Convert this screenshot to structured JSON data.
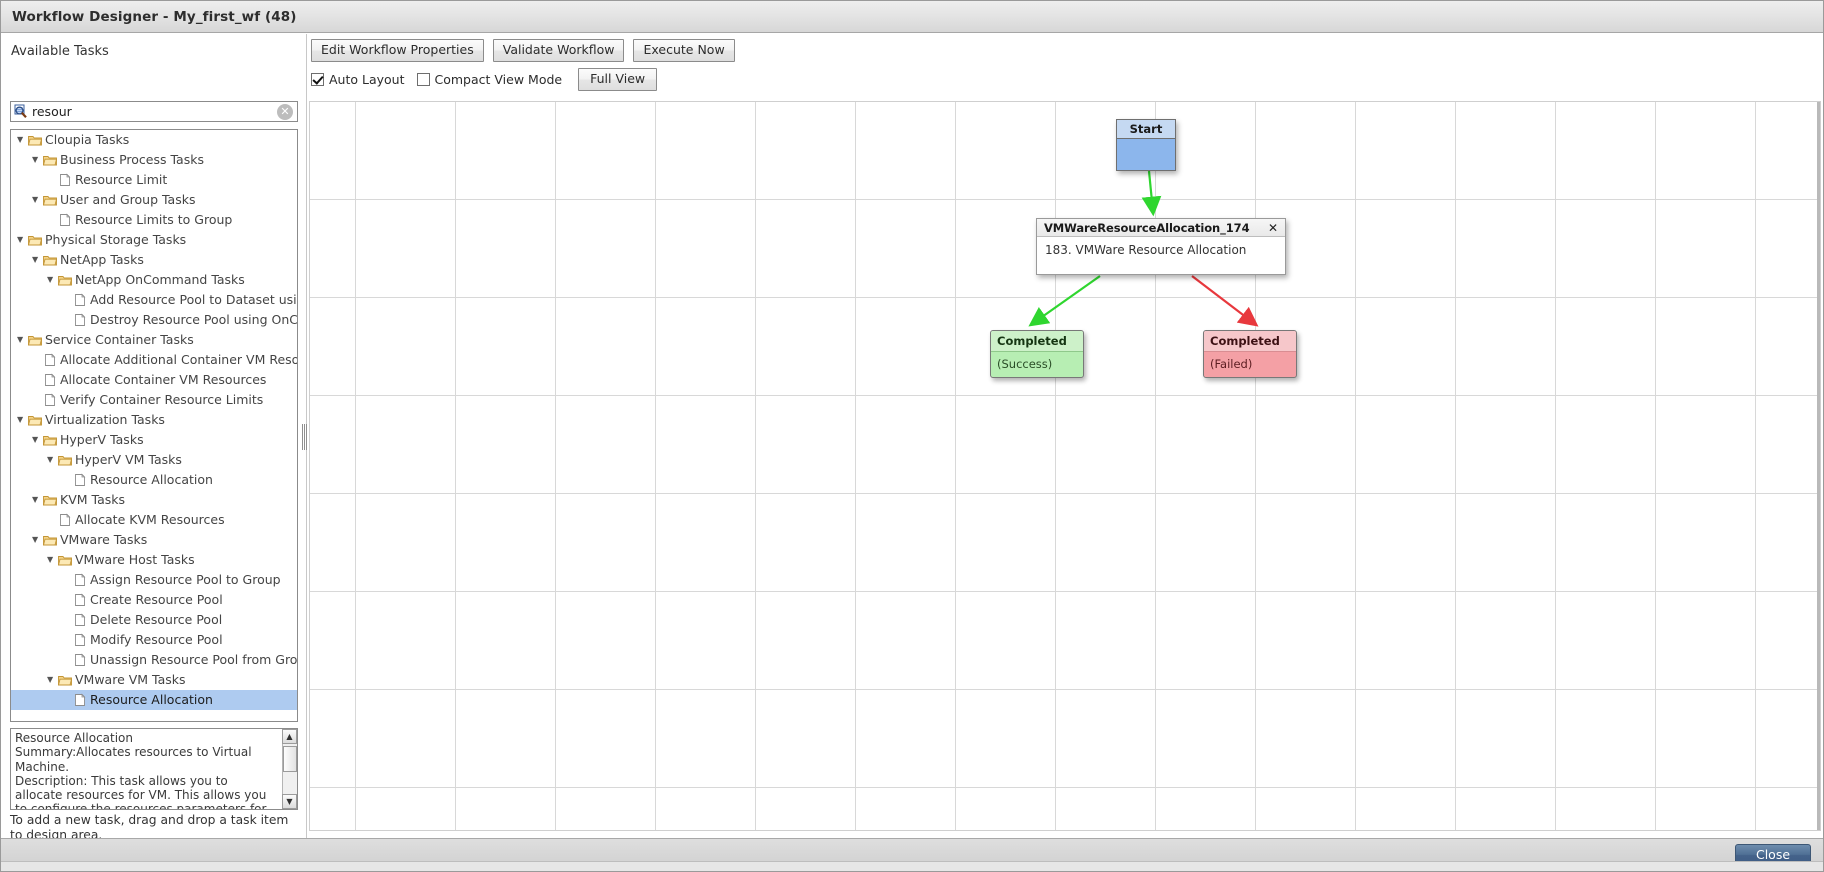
{
  "window": {
    "title": "Workflow Designer - My_first_wf (48)"
  },
  "left_panel": {
    "available_tasks_label": "Available Tasks",
    "search": {
      "value": "resour",
      "placeholder": "",
      "icon": "search-icon",
      "clear_icon": "clear-icon"
    },
    "tree": [
      {
        "label": "Cloupia Tasks",
        "type": "folder",
        "depth": 0,
        "expanded": true,
        "selected": false
      },
      {
        "label": "Business Process Tasks",
        "type": "folder",
        "depth": 1,
        "expanded": true,
        "selected": false
      },
      {
        "label": "Resource Limit",
        "type": "task",
        "depth": 2,
        "expanded": null,
        "selected": false
      },
      {
        "label": "User and Group Tasks",
        "type": "folder",
        "depth": 1,
        "expanded": true,
        "selected": false
      },
      {
        "label": "Resource Limits to Group",
        "type": "task",
        "depth": 2,
        "expanded": null,
        "selected": false
      },
      {
        "label": "Physical Storage Tasks",
        "type": "folder",
        "depth": 0,
        "expanded": true,
        "selected": false
      },
      {
        "label": "NetApp Tasks",
        "type": "folder",
        "depth": 1,
        "expanded": true,
        "selected": false
      },
      {
        "label": "NetApp OnCommand Tasks",
        "type": "folder",
        "depth": 2,
        "expanded": true,
        "selected": false
      },
      {
        "label": "Add Resource Pool to Dataset using",
        "type": "task",
        "depth": 3,
        "expanded": null,
        "selected": false
      },
      {
        "label": "Destroy Resource Pool using OnCo",
        "type": "task",
        "depth": 3,
        "expanded": null,
        "selected": false
      },
      {
        "label": "Service Container Tasks",
        "type": "folder",
        "depth": 0,
        "expanded": true,
        "selected": false
      },
      {
        "label": "Allocate Additional Container VM Resourc",
        "type": "task",
        "depth": 1,
        "expanded": null,
        "selected": false
      },
      {
        "label": "Allocate Container VM Resources",
        "type": "task",
        "depth": 1,
        "expanded": null,
        "selected": false
      },
      {
        "label": "Verify Container Resource Limits",
        "type": "task",
        "depth": 1,
        "expanded": null,
        "selected": false
      },
      {
        "label": "Virtualization Tasks",
        "type": "folder",
        "depth": 0,
        "expanded": true,
        "selected": false
      },
      {
        "label": "HyperV Tasks",
        "type": "folder",
        "depth": 1,
        "expanded": true,
        "selected": false
      },
      {
        "label": "HyperV VM Tasks",
        "type": "folder",
        "depth": 2,
        "expanded": true,
        "selected": false
      },
      {
        "label": "Resource Allocation",
        "type": "task",
        "depth": 3,
        "expanded": null,
        "selected": false
      },
      {
        "label": "KVM Tasks",
        "type": "folder",
        "depth": 1,
        "expanded": true,
        "selected": false
      },
      {
        "label": "Allocate KVM Resources",
        "type": "task",
        "depth": 2,
        "expanded": null,
        "selected": false
      },
      {
        "label": "VMware Tasks",
        "type": "folder",
        "depth": 1,
        "expanded": true,
        "selected": false
      },
      {
        "label": "VMware Host Tasks",
        "type": "folder",
        "depth": 2,
        "expanded": true,
        "selected": false
      },
      {
        "label": "Assign Resource Pool to Group",
        "type": "task",
        "depth": 3,
        "expanded": null,
        "selected": false
      },
      {
        "label": "Create Resource Pool",
        "type": "task",
        "depth": 3,
        "expanded": null,
        "selected": false
      },
      {
        "label": "Delete Resource Pool",
        "type": "task",
        "depth": 3,
        "expanded": null,
        "selected": false
      },
      {
        "label": "Modify Resource Pool",
        "type": "task",
        "depth": 3,
        "expanded": null,
        "selected": false
      },
      {
        "label": "Unassign Resource Pool from Group",
        "type": "task",
        "depth": 3,
        "expanded": null,
        "selected": false
      },
      {
        "label": "VMware VM Tasks",
        "type": "folder",
        "depth": 2,
        "expanded": true,
        "selected": false
      },
      {
        "label": "Resource Allocation",
        "type": "task",
        "depth": 3,
        "expanded": null,
        "selected": true
      }
    ],
    "description": "Resource Allocation\nSummary:Allocates resources to Virtual Machine.\nDescription: This task allows you to allocate resources for VM. This allows you to configure the resources parameters for VM based on catalog and VDC",
    "hint": "To add a new task, drag and drop a task item to design area."
  },
  "toolbar": {
    "edit_workflow_properties": "Edit Workflow Properties",
    "validate_workflow": "Validate Workflow",
    "execute_now": "Execute Now",
    "auto_layout_label": "Auto Layout",
    "auto_layout_checked": true,
    "compact_view_label": "Compact View Mode",
    "compact_view_checked": false,
    "full_view": "Full View"
  },
  "canvas": {
    "nodes": {
      "start": {
        "title": "Start"
      },
      "task": {
        "title": "VMWareResourceAllocation_174",
        "body": "183. VMWare Resource Allocation",
        "close_icon": "close-icon"
      },
      "success": {
        "title": "Completed",
        "subtitle": "(Success)",
        "color": "#b7eeb3"
      },
      "failed": {
        "title": "Completed",
        "subtitle": "(Failed)",
        "color": "#f4a0a5"
      }
    },
    "edges": [
      {
        "from": "start",
        "to": "task",
        "color": "#2fd62f"
      },
      {
        "from": "task",
        "to": "success",
        "color": "#2fd62f"
      },
      {
        "from": "task",
        "to": "failed",
        "color": "#e8383d"
      }
    ]
  },
  "footer": {
    "close_label": "Close"
  }
}
